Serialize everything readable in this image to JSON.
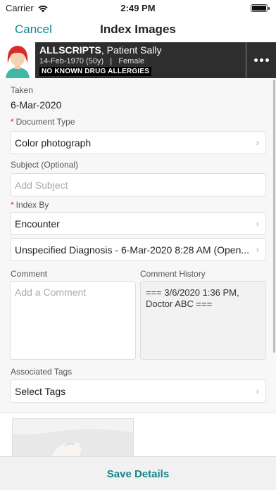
{
  "status_bar": {
    "carrier": "Carrier",
    "time": "2:49 PM",
    "battery_level": 1.0
  },
  "nav": {
    "cancel_label": "Cancel",
    "title": "Index Images"
  },
  "patient": {
    "last_name": "ALLSCRIPTS",
    "first_name": ", Patient Sally",
    "dob": "14-Feb-1970 (50y)",
    "separator": "|",
    "sex": "Female",
    "allergies": "NO KNOWN DRUG ALLERGIES"
  },
  "form": {
    "taken_label": "Taken",
    "taken_value": "6-Mar-2020",
    "doc_type_label": "Document Type",
    "doc_type_value": "Color photograph",
    "subject_label": "Subject (Optional)",
    "subject_placeholder": "Add Subject",
    "index_by_label": "Index By",
    "index_by_value": "Encounter",
    "encounter_value": "Unspecified Diagnosis - 6-Mar-2020 8:28 AM (Open...",
    "comment_label": "Comment",
    "comment_placeholder": "Add a Comment",
    "history_label": "Comment History",
    "history_line1": "=== 3/6/2020 1:36 PM,",
    "history_line2": "Doctor ABC  ===",
    "tags_label": "Associated Tags",
    "tags_value": "Select Tags"
  },
  "footer": {
    "save_label": "Save Details"
  },
  "colors": {
    "accent": "#13878e",
    "required": "#c0292f",
    "patient_bar": "#2e2e2e"
  },
  "icons": [
    "wifi-icon",
    "battery-icon",
    "more-options-icon",
    "chevron-right-icon",
    "patient-avatar"
  ]
}
